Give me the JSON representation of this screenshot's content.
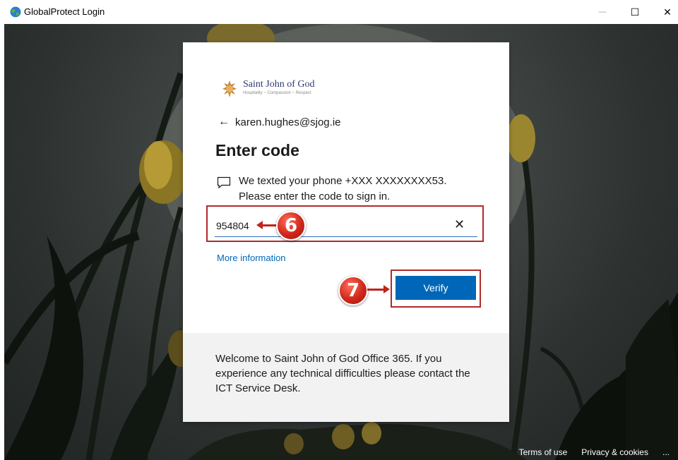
{
  "window": {
    "title": "GlobalProtect Login",
    "controls": {
      "minimize": "—",
      "maximize": "☐",
      "close": "✕"
    }
  },
  "logo": {
    "name": "Saint John of God",
    "tagline": "Hospitality ~ Compassion ~ Respect"
  },
  "signin": {
    "back_arrow": "←",
    "account": "karen.hughes@sjog.ie",
    "heading": "Enter code",
    "message": "We texted your phone +XXX XXXXXXXX53. Please enter the code to sign in.",
    "code_value": "954804",
    "clear_symbol": "✕",
    "more_info": "More information",
    "verify_label": "Verify"
  },
  "annotations": {
    "step_code": "6",
    "step_verify": "7"
  },
  "footer_message": "Welcome to Saint John of God Office 365. If you experience any technical difficulties please contact the ICT Service Desk.",
  "page_footer": {
    "terms": "Terms of use",
    "privacy": "Privacy & cookies",
    "more": "..."
  },
  "colors": {
    "accent": "#0067b8",
    "annotation_red": "#c0241b"
  },
  "icons": [
    "globe-icon",
    "back-arrow-icon",
    "message-icon",
    "clear-icon",
    "logo-crest-icon"
  ]
}
